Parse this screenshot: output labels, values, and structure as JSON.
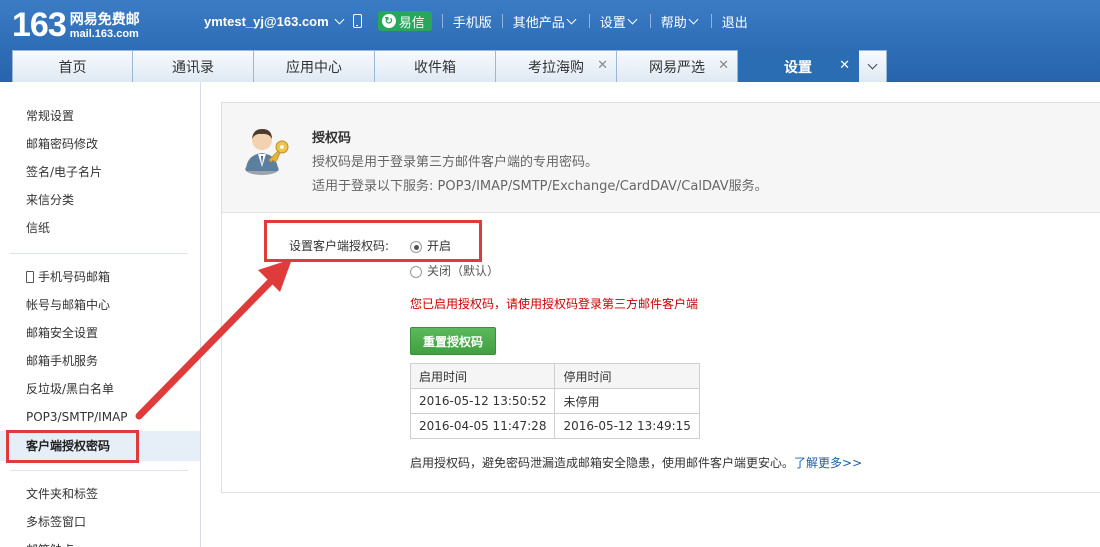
{
  "header": {
    "logo_number": "163",
    "logo_name": "网易免费邮",
    "logo_domain": "mail.163.com",
    "user_email": "ymtest_yj@163.com",
    "yixin_label": "易信",
    "links": [
      "手机版",
      "其他产品",
      "设置",
      "帮助",
      "退出"
    ]
  },
  "tabs": [
    {
      "label": "首页",
      "closable": false,
      "active": false
    },
    {
      "label": "通讯录",
      "closable": false,
      "active": false
    },
    {
      "label": "应用中心",
      "closable": false,
      "active": false
    },
    {
      "label": "收件箱",
      "closable": false,
      "active": false
    },
    {
      "label": "考拉海购",
      "closable": true,
      "active": false
    },
    {
      "label": "网易严选",
      "closable": true,
      "active": false
    },
    {
      "label": "设置",
      "closable": true,
      "active": true
    }
  ],
  "sidebar": {
    "group1": [
      "常规设置",
      "邮箱密码修改",
      "签名/电子名片",
      "来信分类",
      "信纸"
    ],
    "group2": [
      "手机号码邮箱",
      "帐号与邮箱中心",
      "邮箱安全设置",
      "邮箱手机服务",
      "反垃圾/黑白名单",
      "POP3/SMTP/IMAP",
      "客户端授权密码"
    ],
    "group3": [
      "文件夹和标签",
      "多标签窗口",
      "邮箱触点"
    ],
    "active": "客户端授权密码"
  },
  "content": {
    "title": "授权码",
    "desc1": "授权码是用于登录第三方邮件客户端的专用密码。",
    "desc2": "适用于登录以下服务: POP3/IMAP/SMTP/Exchange/CardDAV/CalDAV服务。",
    "option_label": "设置客户端授权码:",
    "radio_on": "开启",
    "radio_off": "关闭（默认）",
    "selected": "开启",
    "notice": "您已启用授权码，请使用授权码登录第三方邮件客户端",
    "reset_button": "重置授权码",
    "table": {
      "headers": [
        "启用时间",
        "停用时间"
      ],
      "rows": [
        [
          "2016-05-12 13:50:52",
          "未停用"
        ],
        [
          "2016-04-05 11:47:28",
          "2016-05-12 13:49:15"
        ]
      ]
    },
    "footnote": "启用授权码，避免密码泄漏造成邮箱安全隐患，使用邮件客户端更安心。",
    "learn_more": "了解更多>>"
  },
  "colors": {
    "header_blue": "#2e6db6",
    "active_tab": "#2b6db3",
    "annotation_red": "#e03b3b",
    "button_green": "#4cae4c",
    "notice_red": "#cc0000"
  }
}
